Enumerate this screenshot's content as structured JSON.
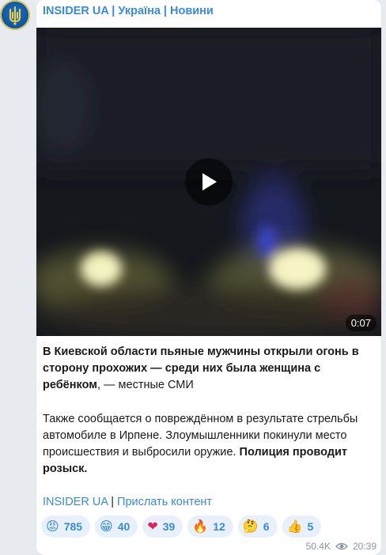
{
  "channel": {
    "title": "INSIDER UA | Україна | Новини"
  },
  "video": {
    "duration": "0:07"
  },
  "post": {
    "p1_bold": "В Киевской области пьяные мужчины открыли огонь в сторону прохожих — среди них была женщина с ребёнком",
    "p1_rest": ", — местные СМИ",
    "p2_text": "Также сообщается о повреждённом в результате стрельбы автомобиле в Ирпене. Злоумышленники покинули место происшествия и выбросили оружие. ",
    "p2_bold": "Полиция проводит розыск.",
    "link1": "INSIDER UA",
    "separator": " | ",
    "link2": "Прислать контент"
  },
  "reactions": [
    {
      "emoji": "😡",
      "count": "785",
      "icon": "angry-face-icon"
    },
    {
      "emoji": "😁",
      "count": "40",
      "icon": "grin-icon"
    },
    {
      "emoji": "❤",
      "count": "39",
      "icon": "heart-icon"
    },
    {
      "emoji": "🔥",
      "count": "12",
      "icon": "fire-icon"
    },
    {
      "emoji": "🤔",
      "count": "6",
      "icon": "thinking-face-icon"
    },
    {
      "emoji": "👍",
      "count": "5",
      "icon": "thumbs-up-icon"
    }
  ],
  "meta": {
    "views": "50.4K",
    "time": "20:39"
  }
}
